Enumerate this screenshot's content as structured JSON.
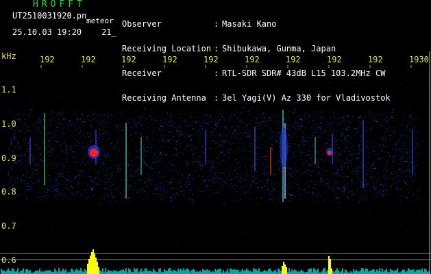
{
  "header": {
    "app_title": "HROFFT",
    "filename": "UT2510031920.pn",
    "tag": "meteor",
    "datetime": "25.10.03 19:20",
    "extra": "21_"
  },
  "meta": [
    {
      "label": "Observer",
      "value": "Masaki Kano"
    },
    {
      "label": "Receiving Location",
      "value": "Shibukawa, Gunma, Japan"
    },
    {
      "label": "Receiver",
      "value": "RTL-SDR SDR# 43dB L15 103.2MHz CW"
    },
    {
      "label": "Receiving Antenna",
      "value": "3el Yagi(V) Az 330 for Vladivostok"
    }
  ],
  "axes": {
    "unit": "kHz",
    "time_ticks": [
      "192",
      "192",
      "192",
      "192",
      "192",
      "192",
      "192",
      "192",
      "192",
      "1930"
    ],
    "freq_ticks": [
      "1.1",
      "1.0",
      "0.9",
      "0.8",
      "0.7",
      "0.6"
    ]
  },
  "colors": {
    "background": "#000000",
    "text_green": "#22dd22",
    "text_white": "#ffffff",
    "text_yellow": "#e8e83c",
    "noise_blue": "#1a2ccc",
    "signal_red": "#ff2020",
    "level_yellow": "#ffff00",
    "level_cyan": "#00e0e0"
  }
}
